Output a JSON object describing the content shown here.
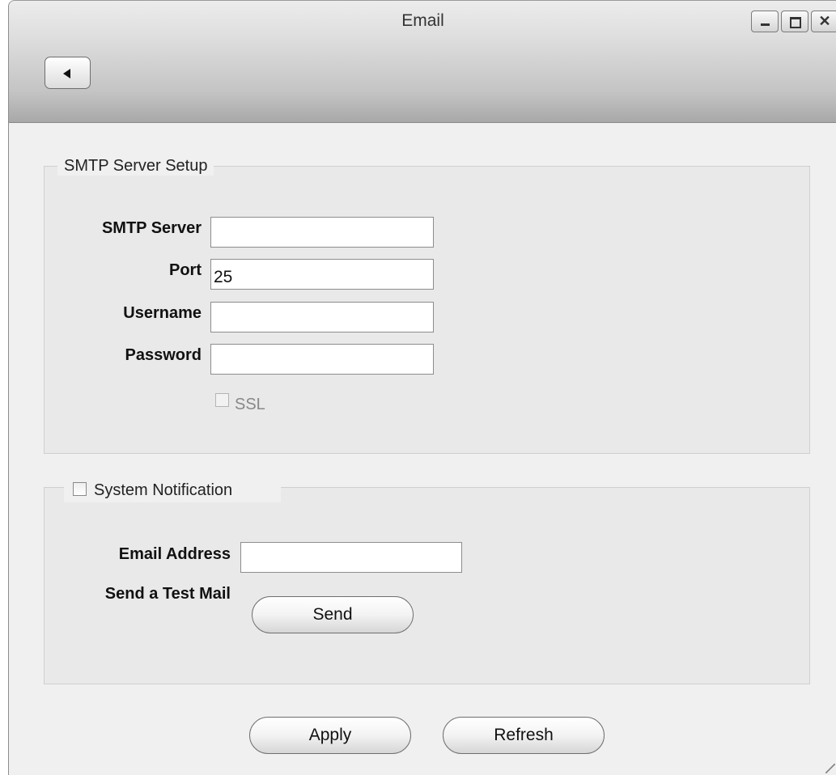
{
  "window": {
    "title": "Email"
  },
  "smtp_group": {
    "legend": "SMTP Server Setup",
    "server_label": "SMTP Server",
    "server_value": "",
    "port_label": "Port",
    "port_value": "25",
    "username_label": "Username",
    "username_value": "",
    "password_label": "Password",
    "password_value": "",
    "ssl_label": "SSL",
    "ssl_checked": false
  },
  "notification_group": {
    "legend": "System Notification",
    "enabled": false,
    "email_label": "Email Address",
    "email_value": "",
    "test_mail_label": "Send a Test Mail",
    "send_button": "Send"
  },
  "footer": {
    "apply_button": "Apply",
    "refresh_button": "Refresh"
  }
}
